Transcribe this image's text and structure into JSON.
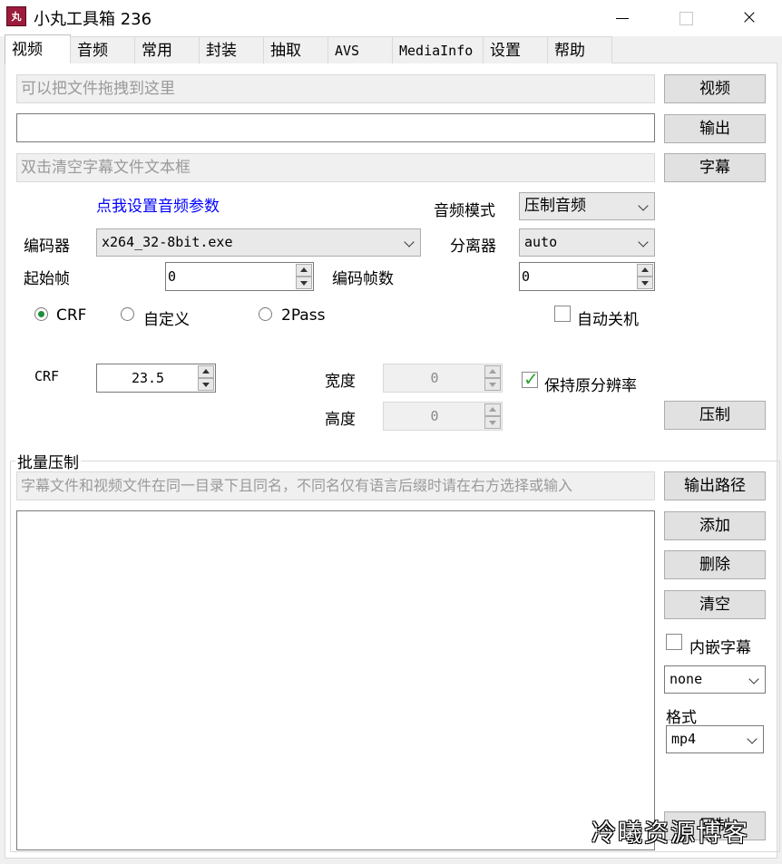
{
  "window": {
    "title": "小丸工具箱 236",
    "icon_text": "丸",
    "minimize": "",
    "maximize": "",
    "close": "×"
  },
  "tabs": [
    {
      "label": "视频",
      "active": true
    },
    {
      "label": "音频"
    },
    {
      "label": "常用"
    },
    {
      "label": "封装"
    },
    {
      "label": "抽取"
    },
    {
      "label": "AVS"
    },
    {
      "label": "MediaInfo"
    },
    {
      "label": "设置"
    },
    {
      "label": "帮助"
    }
  ],
  "video": {
    "video_input_placeholder": "可以把文件拖拽到这里",
    "video_button": "视频",
    "output_value": "",
    "output_button": "输出",
    "subtitle_placeholder": "双击清空字幕文件文本框",
    "subtitle_button": "字幕",
    "audio_settings_link": "点我设置音频参数",
    "audio_mode_label": "音频模式",
    "audio_mode_value": "压制音频",
    "encoder_label": "编码器",
    "encoder_value": "x264_32-8bit.exe",
    "demuxer_label": "分离器",
    "demuxer_value": "auto",
    "start_frame_label": "起始帧",
    "start_frame_value": "0",
    "encode_frames_label": "编码帧数",
    "encode_frames_value": "0",
    "mode_crf": "CRF",
    "mode_custom": "自定义",
    "mode_2pass": "2Pass",
    "auto_shutdown": "自动关机",
    "crf_label": "CRF",
    "crf_value": "23.5",
    "width_label": "宽度",
    "width_value": "0",
    "height_label": "高度",
    "height_value": "0",
    "keep_resolution": "保持原分辨率",
    "encode_button": "压制"
  },
  "batch": {
    "group_label": "批量压制",
    "hint_placeholder": "字幕文件和视频文件在同一目录下且同名，不同名仅有语言后缀时请在右方选择或输入",
    "output_path_button": "输出路径",
    "add_button": "添加",
    "delete_button": "删除",
    "clear_button": "清空",
    "embed_subtitle": "内嵌字幕",
    "subtitle_lang_value": "none",
    "format_label": "格式",
    "format_value": "mp4",
    "encode_button": "压制"
  },
  "watermark": "冷曦资源博客"
}
